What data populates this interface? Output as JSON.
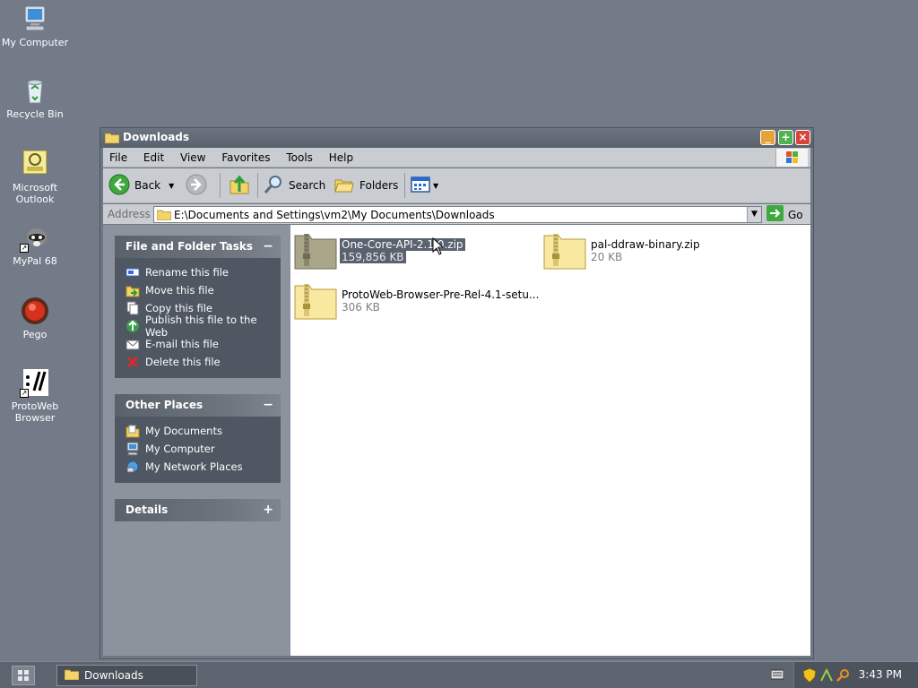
{
  "desktop": {
    "icons": [
      {
        "label": "My Computer"
      },
      {
        "label": "Recycle Bin"
      },
      {
        "label": "Microsoft Outlook"
      },
      {
        "label": "MyPal 68"
      },
      {
        "label": "Pego"
      },
      {
        "label": "ProtoWeb Browser"
      }
    ]
  },
  "window": {
    "title": "Downloads",
    "menu": [
      "File",
      "Edit",
      "View",
      "Favorites",
      "Tools",
      "Help"
    ],
    "toolbar": {
      "back_label": "Back",
      "search_label": "Search",
      "folders_label": "Folders"
    },
    "address": {
      "label": "Address",
      "path": "E:\\Documents and Settings\\vm2\\My Documents\\Downloads",
      "go_label": "Go"
    },
    "tasks_panel": {
      "title": "File and Folder Tasks",
      "toggle": "−",
      "items": [
        {
          "label": "Rename this file",
          "icon": "rename-icon"
        },
        {
          "label": "Move this file",
          "icon": "move-icon"
        },
        {
          "label": "Copy this file",
          "icon": "copy-icon"
        },
        {
          "label": "Publish this file to the Web",
          "icon": "publish-icon"
        },
        {
          "label": "E-mail this file",
          "icon": "email-icon"
        },
        {
          "label": "Delete this file",
          "icon": "delete-icon"
        }
      ]
    },
    "places_panel": {
      "title": "Other Places",
      "toggle": "−",
      "items": [
        {
          "label": "My Documents"
        },
        {
          "label": "My Computer"
        },
        {
          "label": "My Network Places"
        }
      ]
    },
    "details_panel": {
      "title": "Details",
      "toggle": "+"
    },
    "files": [
      {
        "name": "One-Core-API-2.1.0.zip",
        "size": "159,856 KB",
        "selected": true
      },
      {
        "name": "pal-ddraw-binary.zip",
        "size": "20 KB",
        "selected": false
      },
      {
        "name": "ProtoWeb-Browser-Pre-Rel-4.1-setu...",
        "size": "306 KB",
        "selected": false
      }
    ]
  },
  "taskbar": {
    "task_label": "Downloads",
    "clock": "3:43 PM"
  },
  "colors": {
    "desktop": "#737b88",
    "selection": "#5a6270",
    "panel_body": "#4f5762"
  }
}
